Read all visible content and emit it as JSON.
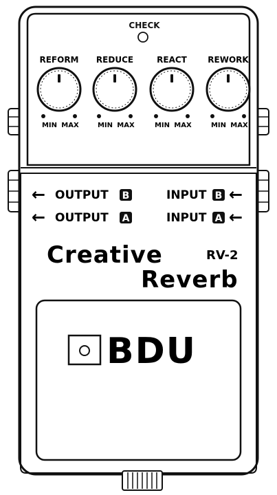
{
  "check_label": "CHECK",
  "knobs": [
    {
      "label": "REFORM",
      "min_label": "MIN",
      "max_label": "MAX"
    },
    {
      "label": "REDUCE",
      "min_label": "MIN",
      "max_label": "MAX"
    },
    {
      "label": "REACT",
      "min_label": "MIN",
      "max_label": "MAX"
    },
    {
      "label": "REWORK",
      "min_label": "MIN",
      "max_label": "MAX"
    }
  ],
  "jacks": {
    "output_b": {
      "text": "OUTPUT",
      "badge": "B"
    },
    "output_a": {
      "text": "OUTPUT",
      "badge": "A"
    },
    "input_b": {
      "text": "INPUT",
      "badge": "B"
    },
    "input_a": {
      "text": "INPUT",
      "badge": "A"
    }
  },
  "product": {
    "line1": "Creative",
    "line2": "Reverb",
    "model": "RV-2"
  },
  "brand": {
    "logo_text": "BDU"
  },
  "colors": {
    "ink": "#111111",
    "body": "#ffffff"
  }
}
